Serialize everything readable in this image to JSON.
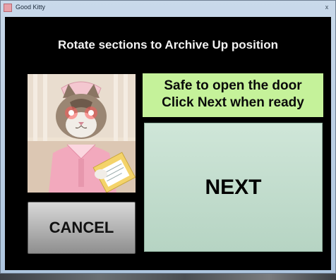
{
  "window": {
    "title": "Good Kitty",
    "close_glyph": "x"
  },
  "main": {
    "instruction": "Rotate sections to Archive Up position",
    "status_line_1": "Safe to open the door",
    "status_line_2": "Click Next when ready",
    "next_label": "NEXT",
    "cancel_label": "CANCEL",
    "photo_name": "cat-nurse-photo"
  },
  "colors": {
    "client_background": "#000000",
    "status_background": "#c5f29a",
    "next_background": "#c5e0cf",
    "cancel_background": "#a8a8a8"
  }
}
